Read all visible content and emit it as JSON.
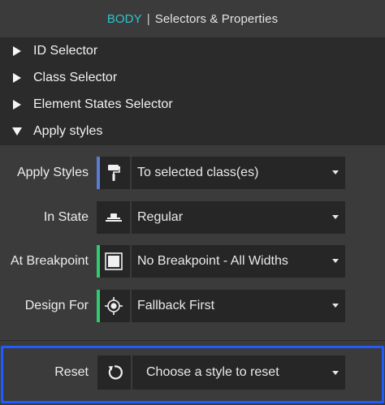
{
  "header": {
    "tag": "BODY",
    "separator": "|",
    "title": "Selectors & Properties",
    "tag_color": "#2ec4cf"
  },
  "sections": [
    {
      "label": "ID Selector",
      "expanded": false
    },
    {
      "label": "Class Selector",
      "expanded": false
    },
    {
      "label": "Element States Selector",
      "expanded": false
    },
    {
      "label": "Apply styles",
      "expanded": true
    }
  ],
  "apply_styles": {
    "rows": [
      {
        "label": "Apply Styles",
        "icon": "paint-roller-icon",
        "accent_color": "#5b7bd6",
        "value": "To selected class(es)"
      },
      {
        "label": "In State",
        "icon": "cursor-state-icon",
        "accent_color": "",
        "value": "Regular"
      },
      {
        "label": "At Breakpoint",
        "icon": "screen-icon",
        "accent_color": "#2ecc71",
        "value": "No Breakpoint - All Widths"
      },
      {
        "label": "Design For",
        "icon": "crosshair-icon",
        "accent_color": "#2ecc71",
        "value": "Fallback First"
      }
    ]
  },
  "reset": {
    "label": "Reset",
    "icon": "reset-icon",
    "value": "Choose a style to reset",
    "highlight_color": "#1f5cff"
  }
}
